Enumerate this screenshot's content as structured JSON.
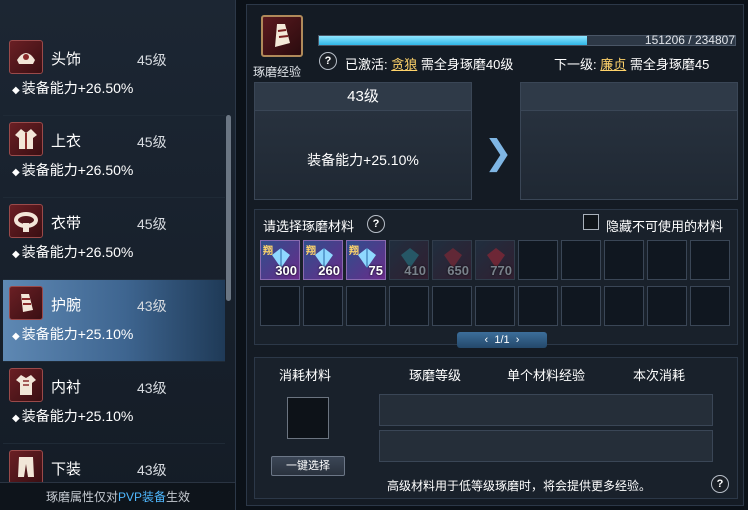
{
  "left": {
    "items": [
      {
        "name": "头饰",
        "level": "45级",
        "stat": "装备能力+26.50%"
      },
      {
        "name": "上衣",
        "level": "45级",
        "stat": "装备能力+26.50%"
      },
      {
        "name": "衣带",
        "level": "45级",
        "stat": "装备能力+26.50%"
      },
      {
        "name": "护腕",
        "level": "43级",
        "stat": "装备能力+25.10%"
      },
      {
        "name": "内衬",
        "level": "43级",
        "stat": "装备能力+25.10%"
      },
      {
        "name": "下装",
        "level": "43级",
        "stat": ""
      }
    ],
    "selected_index": 3,
    "footer_prefix": "琢磨属性仅对",
    "footer_highlight": "PVP装备",
    "footer_suffix": "生效"
  },
  "header": {
    "skill_label": "琢磨经验",
    "xp_text": "151206 / 234807",
    "xp_progress": 0.644,
    "active_prefix": "已激活:",
    "active_name": "贪狼",
    "active_req": "需全身琢磨40级",
    "next_prefix": "下一级:",
    "next_name": "廉贞",
    "next_req": "需全身琢磨45",
    "help": "?"
  },
  "current_card": {
    "level": "43级",
    "stat": "装备能力+25.10%"
  },
  "next_card": {
    "level": "",
    "stat": ""
  },
  "materials": {
    "title": "请选择琢磨材料",
    "hide_label": "隐藏不可使用的材料",
    "items": [
      {
        "tag": "翔",
        "count": "300",
        "usable": true
      },
      {
        "tag": "翔",
        "count": "260",
        "usable": true
      },
      {
        "tag": "翔",
        "count": "75",
        "usable": true
      },
      {
        "tag": "",
        "count": "410",
        "usable": false
      },
      {
        "tag": "",
        "count": "650",
        "usable": false
      },
      {
        "tag": "",
        "count": "770",
        "usable": false
      }
    ],
    "slot_count": 22,
    "page": "1/1"
  },
  "consume": {
    "col_material": "消耗材料",
    "col_level": "琢磨等级",
    "col_single": "单个材料经验",
    "col_this": "本次消耗",
    "one_click": "一键选择",
    "tip": "高级材料用于低等级琢磨时，将会提供更多经验。"
  },
  "colors": {
    "accent": "#4fb8ff",
    "xp": "#2fb6e6",
    "highlight": "#ffd36a",
    "selected": "#5e88b3"
  }
}
